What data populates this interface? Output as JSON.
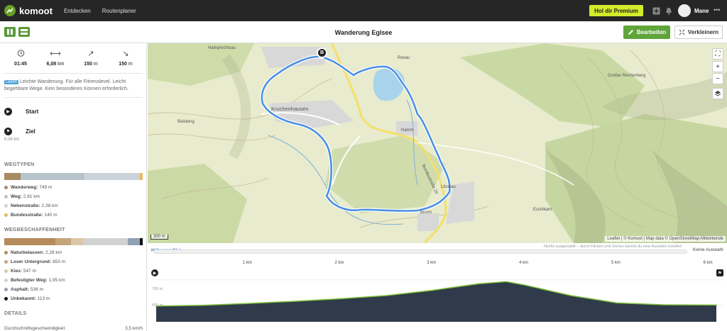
{
  "header": {
    "brand": "komoot",
    "nav": [
      "Entdecken",
      "Routenplaner"
    ],
    "premium_label": "Hol dir Premium",
    "user_name": "Mane",
    "more": "•••"
  },
  "toolbar": {
    "title": "Wanderung Eglsee",
    "edit_label": "Bearbeiten",
    "shrink_label": "Verkleinern"
  },
  "stats": [
    {
      "icon": "clock-icon",
      "value": "01:45",
      "unit": ""
    },
    {
      "icon": "distance-icon",
      "value": "6,08",
      "unit": " km"
    },
    {
      "icon": "uphill-icon",
      "value": "150",
      "unit": " m"
    },
    {
      "icon": "downhill-icon",
      "value": "150",
      "unit": " m"
    }
  ],
  "difficulty": {
    "badge": "Leicht",
    "text": "Leichte Wanderung. Für alle Fitnesslevel. Leicht begehbare Wege. Kein besonderes Können erforderlich."
  },
  "waypoints": {
    "start": "Start",
    "end": "Ziel",
    "end_distance": "6,08 km"
  },
  "way_types": {
    "title": "WEGTYPEN",
    "items": [
      {
        "name": "Wanderweg:",
        "value": "749 m",
        "fraction": 0.12,
        "color": "#a88b63"
      },
      {
        "name": "Weg:",
        "value": "2,81 km",
        "fraction": 0.46,
        "color": "#b8c4cc"
      },
      {
        "name": "Nebenstraße:",
        "value": "2,38 km",
        "fraction": 0.4,
        "color": "#c9d3d9"
      },
      {
        "name": "Bundesstraße:",
        "value": "140 m",
        "fraction": 0.02,
        "color": "#e8b860"
      }
    ]
  },
  "surfaces": {
    "title": "WEGBESCHAFFENHEIT",
    "items": [
      {
        "name": "Naturbelassen:",
        "value": "2,28 km",
        "fraction": 0.37,
        "color": "#b58b5a"
      },
      {
        "name": "Loser Untergrund:",
        "value": "653 m",
        "fraction": 0.11,
        "color": "#c4a57a"
      },
      {
        "name": "Kies:",
        "value": "547 m",
        "fraction": 0.09,
        "color": "#dbc7a5"
      },
      {
        "name": "Befestigter Weg:",
        "value": "1,95 km",
        "fraction": 0.32,
        "color": "#d2d2d2"
      },
      {
        "name": "Asphalt:",
        "value": "536 m",
        "fraction": 0.09,
        "color": "#8fa2b3"
      },
      {
        "name": "Unbekannt:",
        "value": "113 m",
        "fraction": 0.02,
        "color": "#111111"
      }
    ]
  },
  "details": {
    "title": "DETAILS",
    "items": [
      {
        "name": "Durchschnittsgeschwindigkeit",
        "value": "3,5 km/h"
      }
    ]
  },
  "map": {
    "labels": [
      "Hamprechtsau",
      "Rexau",
      "Kruchenhausen",
      "Balsberg",
      "Hamm",
      "Bundesstraße 20",
      "Litzelau",
      "Brunn",
      "Großer Rechenberg",
      "Eschlkam"
    ],
    "scale": "300 m",
    "attribution": "Leaflet | © Komoot | Map data © OpenStreetMap-Mitwirkende",
    "zoom_in": "+",
    "zoom_out": "−",
    "route_color": "#4a90e2",
    "start_marker": "B"
  },
  "profile": {
    "tab": "Höhenprofil ▾",
    "hint": "Nichts ausgewählt – durch Klicken und Ziehen kannst du eine Auswahl erstellen",
    "none_selected": "Keine Auswahl",
    "km_ticks": [
      "1 km",
      "2 km",
      "3 km",
      "4 km",
      "5 km",
      "6 km"
    ],
    "y_ticks": [
      "700 m",
      "600 m"
    ]
  },
  "chart_data": {
    "type": "area",
    "x": [
      0,
      0.5,
      1,
      1.5,
      2,
      2.5,
      3,
      3.5,
      3.8,
      4,
      4.5,
      5,
      5.5,
      6.08
    ],
    "values": [
      600,
      603,
      610,
      618,
      628,
      640,
      660,
      685,
      693,
      680,
      640,
      612,
      605,
      604
    ],
    "xlabel": "",
    "ylabel": "",
    "ylim": [
      540,
      740
    ]
  }
}
